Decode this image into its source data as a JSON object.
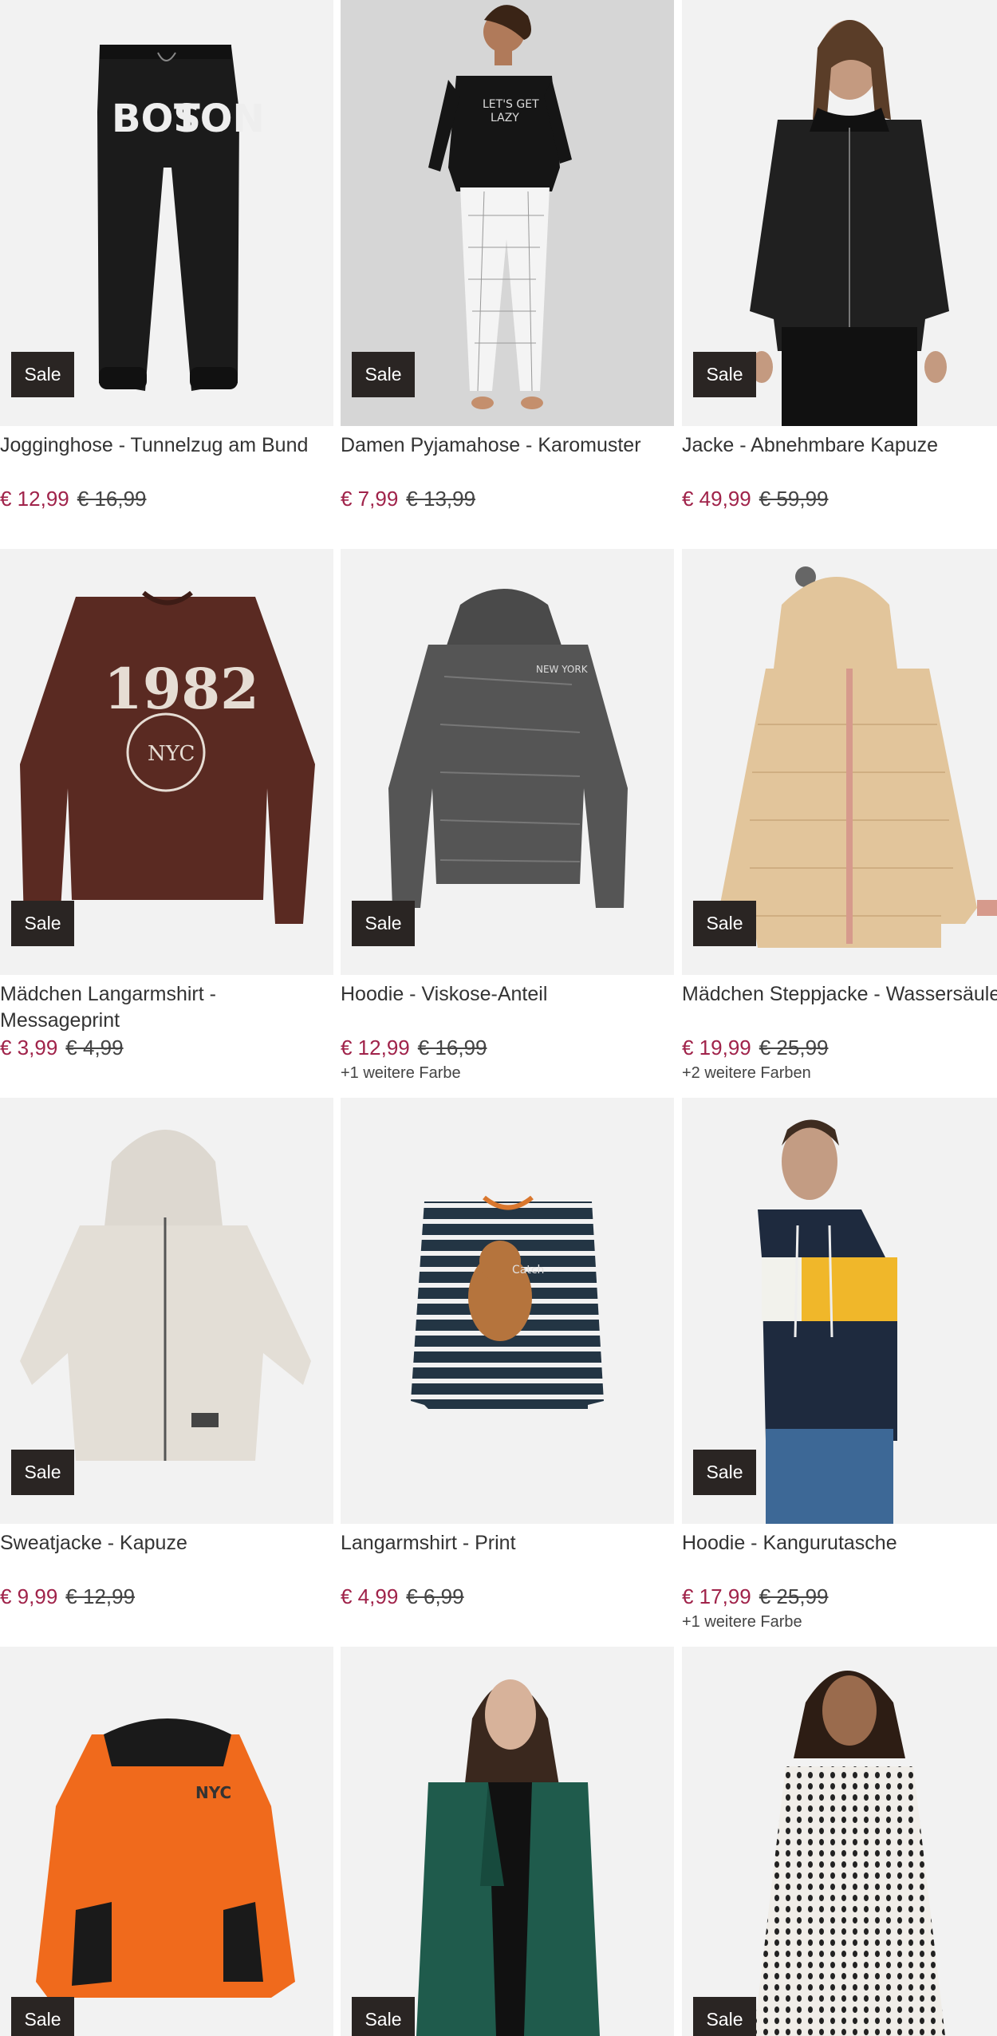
{
  "sale_label": "Sale",
  "colors": {
    "price_sale": "#a0234a",
    "badge_bg": "#2a2523",
    "tile_bg": "#f2f2f2"
  },
  "products": [
    {
      "title": "Jogginghose - Tunnelzug am Bund",
      "price": "€ 12,99",
      "old_price": "€ 16,99",
      "more_colors": "",
      "image": "black-jogging-pants-boston"
    },
    {
      "title": "Damen Pyjamahose - Karomuster",
      "price": "€ 7,99",
      "old_price": "€ 13,99",
      "more_colors": "",
      "image": "woman-pyjama-checked"
    },
    {
      "title": "Jacke - Abnehmbare Kapuze",
      "price": "€ 49,99",
      "old_price": "€ 59,99",
      "more_colors": "",
      "image": "man-black-jacket"
    },
    {
      "title": "Mädchen Langarmshirt - Messageprint",
      "price": "€ 3,99",
      "old_price": "€ 4,99",
      "more_colors": "",
      "image": "brown-longsleeve-1982"
    },
    {
      "title": "Hoodie - Viskose-Anteil",
      "price": "€ 12,99",
      "old_price": "€ 16,99",
      "more_colors": "+1 weitere Farbe",
      "image": "grey-knit-hoodie"
    },
    {
      "title": "Mädchen Steppjacke - Wassersäule",
      "price": "€ 19,99",
      "old_price": "€ 25,99",
      "more_colors": "+2 weitere Farben",
      "image": "beige-puffer-jacket"
    },
    {
      "title": "Sweatjacke - Kapuze",
      "price": "€ 9,99",
      "old_price": "€ 12,99",
      "more_colors": "",
      "image": "light-grey-zip-hoodie"
    },
    {
      "title": "Langarmshirt - Print",
      "price": "€ 4,99",
      "old_price": "€ 6,99",
      "more_colors": "",
      "image": "striped-kids-shirt-bear"
    },
    {
      "title": "Hoodie - Kangurutasche",
      "price": "€ 17,99",
      "old_price": "€ 25,99",
      "more_colors": "+1 weitere Farbe",
      "image": "man-colorblock-hoodie"
    },
    {
      "title": "",
      "price": "",
      "old_price": "",
      "more_colors": "",
      "image": "orange-kids-hoodie"
    },
    {
      "title": "",
      "price": "",
      "old_price": "",
      "more_colors": "",
      "image": "woman-green-blazer"
    },
    {
      "title": "",
      "price": "",
      "old_price": "",
      "more_colors": "",
      "image": "woman-patterned-dress"
    }
  ]
}
